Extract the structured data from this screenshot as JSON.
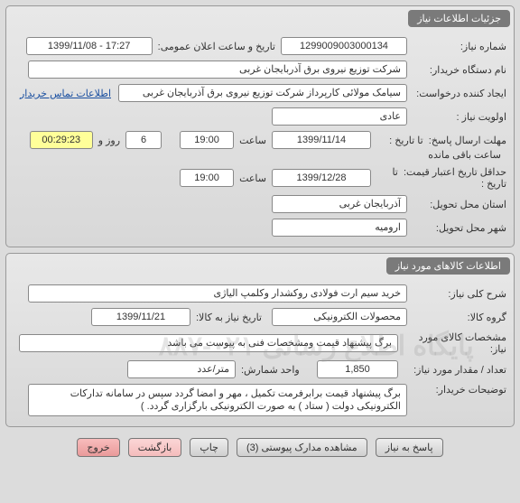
{
  "need_info": {
    "panel_title": "جزئیات اطلاعات نیاز",
    "labels": {
      "need_no": "شماره نیاز:",
      "announce": "تاریخ و ساعت اعلان عمومی:",
      "buyer": "نام دستگاه خریدار:",
      "creator": "ایجاد کننده درخواست:",
      "priority": "اولویت نیاز :",
      "deadline": "مهلت ارسال پاسخ:",
      "to_date": "تا تاریخ :",
      "sa_at": "ساعت",
      "rooz_va": "روز و",
      "remain": "ساعت باقی مانده",
      "min_valid": "حداقل تاریخ اعتبار قیمت:",
      "province": "استان محل تحویل:",
      "city": "شهر محل تحویل:"
    },
    "need_no": "1299009003000134",
    "announce": "1399/11/08 - 17:27",
    "buyer": "شرکت توزیع نیروی برق آذربایجان غربی",
    "creator": "سیامک مولائی کارپرداز شرکت توزیع نیروی برق آذربایجان غربی",
    "priority": "عادی",
    "deadline_date": "1399/11/14",
    "deadline_time": "19:00",
    "remain_days": "6",
    "remain_time": "00:29:23",
    "valid_date": "1399/12/28",
    "valid_time": "19:00",
    "province": "آذربایجان غربی",
    "city": "ارومیه"
  },
  "contact_link": "اطلاعات تماس خریدار",
  "goods_info": {
    "panel_title": "اطلاعات کالاهای مورد نیاز",
    "labels": {
      "general_desc": "شرح کلی نیاز:",
      "group": "گروه کالا:",
      "need_by": "تاریخ نیاز به کالا:",
      "spec": "مشخصات کالای مورد نیاز:",
      "qty": "تعداد / مقدار مورد نیاز:",
      "unit": "واحد شمارش:",
      "buyer_notes": "توضیحات خریدار:"
    },
    "general_desc": "خرید سیم ارت فولادی روکشدار وکلمپ الیاژی",
    "group": "محصولات الکترونیکی",
    "need_by": "1399/11/21",
    "spec": "برگ پیشنهاد قیمت ومشخصات فنی به پیوست می باشد",
    "qty": "1,850",
    "unit": "متر/عدد",
    "buyer_notes": "برگ پیشنهاد قیمت برابرفرمت تکمیل ، مهر و امضا گردد سپس در سامانه تدارکات الکترونیکی دولت ( ستاد ) به صورت الکترونیکی  بارگزاری گردد. )"
  },
  "buttons": {
    "respond": "پاسخ به نیاز",
    "attachments": "مشاهده مدارک پیوستی (3)",
    "print": "چاپ",
    "back": "بازگشت",
    "exit": "خروج"
  },
  "watermark": "پایگاه اطلاع رسانی\n۰۲۱-۸۸۷"
}
